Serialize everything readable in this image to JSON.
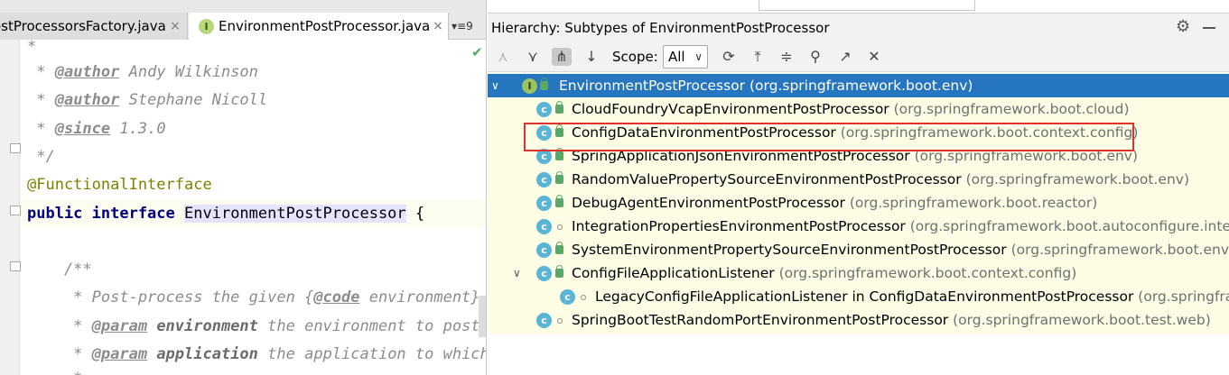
{
  "editor": {
    "tabs": [
      {
        "label": "ostProcessorsFactory.java",
        "close": "×"
      },
      {
        "label": "EnvironmentPostProcessor.java",
        "icon": "I",
        "close": "×"
      }
    ],
    "tab_overflow": "▾≡9",
    "lines": {
      "l1": "*",
      "l2_star": " * ",
      "l2_tag": "@author",
      "l2_rest": " Andy Wilkinson",
      "l3_star": " * ",
      "l3_tag": "@author",
      "l3_rest": " Stephane Nicoll",
      "l4_star": " * ",
      "l4_tag": "@since",
      "l4_rest": " 1.3.0",
      "l5": " */",
      "l6": "@FunctionalInterface",
      "l7_kw": "public interface",
      "l7_name": "EnvironmentPostProcessor",
      "l7_rest": " {",
      "l8": "",
      "l9": "    /**",
      "l10_a": "     * Post-process the given {",
      "l10_tag": "@code",
      "l10_b": " environment}.",
      "l11_star": "     * ",
      "l11_tag": "@param",
      "l11_b": " environment",
      "l11_c": " the environment to post-p",
      "l12_star": "     * ",
      "l12_tag": "@param",
      "l12_b": " application",
      "l12_c": " the application to which",
      "l13": "     *"
    }
  },
  "hierarchy": {
    "title": "Hierarchy:  Subtypes of EnvironmentPostProcessor",
    "scope_label": "Scope:",
    "scope_value": "All",
    "tree": [
      {
        "name": "EnvironmentPostProcessor",
        "pkg": "(org.springframework.boot.env)"
      },
      {
        "name": "CloudFoundryVcapEnvironmentPostProcessor",
        "pkg": "(org.springframework.boot.cloud)"
      },
      {
        "name": "ConfigDataEnvironmentPostProcessor",
        "pkg": "(org.springframework.boot.context.config)"
      },
      {
        "name": "SpringApplicationJsonEnvironmentPostProcessor",
        "pkg": "(org.springframework.boot.env)"
      },
      {
        "name": "RandomValuePropertySourceEnvironmentPostProcessor",
        "pkg": "(org.springframework.boot.env)"
      },
      {
        "name": "DebugAgentEnvironmentPostProcessor",
        "pkg": "(org.springframework.boot.reactor)"
      },
      {
        "name": "IntegrationPropertiesEnvironmentPostProcessor",
        "pkg": "(org.springframework.boot.autoconfigure.integrati"
      },
      {
        "name": "SystemEnvironmentPropertySourceEnvironmentPostProcessor",
        "pkg": "(org.springframework.boot.env)"
      },
      {
        "name": "ConfigFileApplicationListener",
        "pkg": "(org.springframework.boot.context.config)"
      },
      {
        "name": "LegacyConfigFileApplicationListener in ConfigDataEnvironmentPostProcessor",
        "pkg": "(org.springframew"
      },
      {
        "name": "SpringBootTestRandomPortEnvironmentPostProcessor",
        "pkg": "(org.springframework.boot.test.web)"
      }
    ]
  },
  "colors": {
    "selection": "#2675bf",
    "highlight_box": "#e0312f",
    "tree_bg": "#fdfce5"
  }
}
